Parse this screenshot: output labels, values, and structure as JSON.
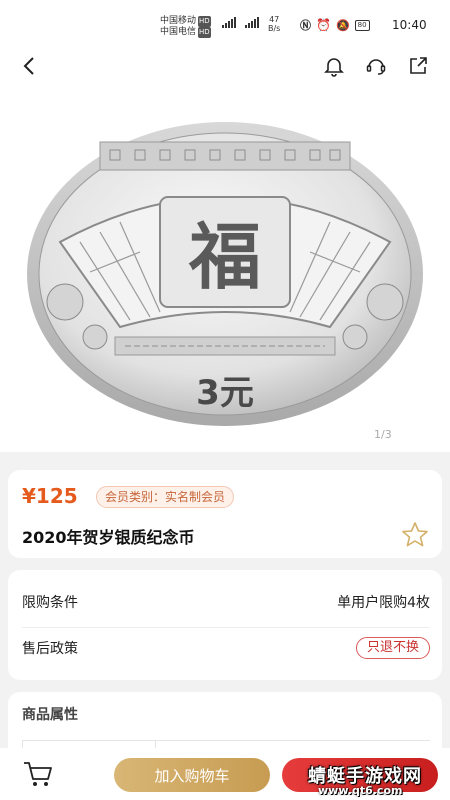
{
  "status_bar": {
    "carrier_1": "中国移动",
    "carrier_2": "中国电信",
    "hd_label": "HD",
    "net_speed_value": "47",
    "net_speed_unit": "B/s",
    "battery": "80",
    "time": "10:40"
  },
  "nav": {
    "back_icon": "chevron-left-icon",
    "bell_icon": "bell-icon",
    "service_icon": "customer-service-icon",
    "share_icon": "share-icon"
  },
  "hero": {
    "coin_denomination": "3元",
    "pager": "1/3"
  },
  "product": {
    "price": "¥125",
    "member_tag": "会员类别：实名制会员",
    "title": "2020年贺岁银质纪念币"
  },
  "policy": {
    "purchase_label": "限购条件",
    "purchase_value": "单用户限购4枚",
    "aftersale_label": "售后政策",
    "aftersale_value": "只退不换"
  },
  "attributes": {
    "title": "商品属性"
  },
  "bottom_bar": {
    "add_to_cart": "加入购物车"
  },
  "watermark": {
    "text": "蜻蜓手游戏网",
    "url": "www.qt6.com"
  },
  "colors": {
    "price": "#e55a1d",
    "accent_gold": "#c79c52",
    "accent_red": "#d62828"
  }
}
